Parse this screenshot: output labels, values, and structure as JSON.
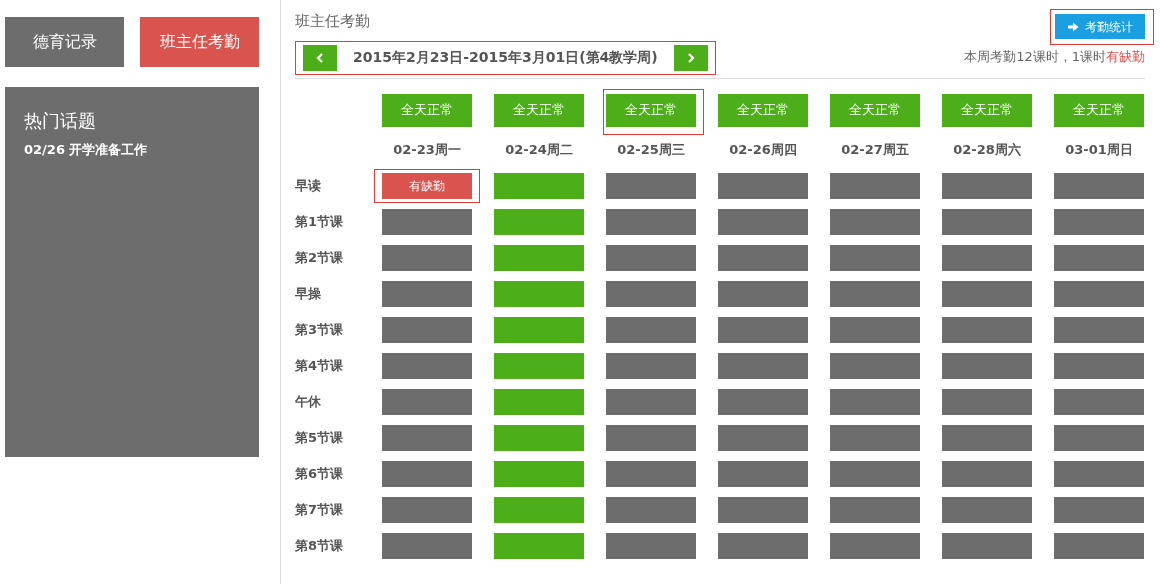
{
  "sidebar": {
    "buttons": [
      {
        "label": "德育记录",
        "selected": false
      },
      {
        "label": "班主任考勤",
        "selected": true
      }
    ],
    "hot_topics": {
      "title": "热门话题",
      "items": [
        "02/26 开学准备工作"
      ]
    }
  },
  "main": {
    "title": "班主任考勤",
    "stats_button": {
      "label": "考勤统计",
      "highlighted": true
    },
    "week_nav": {
      "range": "2015年2月23日-2015年3月01日(第4教学周)",
      "highlighted": true
    },
    "summary": {
      "text": "本周考勤12课时，1课时",
      "alert": "有缺勤"
    },
    "days": [
      {
        "status": "全天正常",
        "date": "02-23周一",
        "highlighted": false
      },
      {
        "status": "全天正常",
        "date": "02-24周二",
        "highlighted": false
      },
      {
        "status": "全天正常",
        "date": "02-25周三",
        "highlighted": true
      },
      {
        "status": "全天正常",
        "date": "02-26周四",
        "highlighted": false
      },
      {
        "status": "全天正常",
        "date": "02-27周五",
        "highlighted": false
      },
      {
        "status": "全天正常",
        "date": "02-28周六",
        "highlighted": false
      },
      {
        "status": "全天正常",
        "date": "03-01周日",
        "highlighted": false
      }
    ],
    "rows": [
      {
        "label": "早读",
        "cells": [
          {
            "kind": "absent",
            "text": "有缺勤",
            "highlighted": true
          },
          {
            "kind": "normal"
          },
          {
            "kind": "empty"
          },
          {
            "kind": "empty"
          },
          {
            "kind": "empty"
          },
          {
            "kind": "empty"
          },
          {
            "kind": "empty"
          }
        ]
      },
      {
        "label": "第1节课",
        "cells": [
          {
            "kind": "empty"
          },
          {
            "kind": "normal"
          },
          {
            "kind": "empty"
          },
          {
            "kind": "empty"
          },
          {
            "kind": "empty"
          },
          {
            "kind": "empty"
          },
          {
            "kind": "empty"
          }
        ]
      },
      {
        "label": "第2节课",
        "cells": [
          {
            "kind": "empty"
          },
          {
            "kind": "normal"
          },
          {
            "kind": "empty"
          },
          {
            "kind": "empty"
          },
          {
            "kind": "empty"
          },
          {
            "kind": "empty"
          },
          {
            "kind": "empty"
          }
        ]
      },
      {
        "label": "早操",
        "cells": [
          {
            "kind": "empty"
          },
          {
            "kind": "normal"
          },
          {
            "kind": "empty"
          },
          {
            "kind": "empty"
          },
          {
            "kind": "empty"
          },
          {
            "kind": "empty"
          },
          {
            "kind": "empty"
          }
        ]
      },
      {
        "label": "第3节课",
        "cells": [
          {
            "kind": "empty"
          },
          {
            "kind": "normal"
          },
          {
            "kind": "empty"
          },
          {
            "kind": "empty"
          },
          {
            "kind": "empty"
          },
          {
            "kind": "empty"
          },
          {
            "kind": "empty"
          }
        ]
      },
      {
        "label": "第4节课",
        "cells": [
          {
            "kind": "empty"
          },
          {
            "kind": "normal"
          },
          {
            "kind": "empty"
          },
          {
            "kind": "empty"
          },
          {
            "kind": "empty"
          },
          {
            "kind": "empty"
          },
          {
            "kind": "empty"
          }
        ]
      },
      {
        "label": "午休",
        "cells": [
          {
            "kind": "empty"
          },
          {
            "kind": "normal"
          },
          {
            "kind": "empty"
          },
          {
            "kind": "empty"
          },
          {
            "kind": "empty"
          },
          {
            "kind": "empty"
          },
          {
            "kind": "empty"
          }
        ]
      },
      {
        "label": "第5节课",
        "cells": [
          {
            "kind": "empty"
          },
          {
            "kind": "normal"
          },
          {
            "kind": "empty"
          },
          {
            "kind": "empty"
          },
          {
            "kind": "empty"
          },
          {
            "kind": "empty"
          },
          {
            "kind": "empty"
          }
        ]
      },
      {
        "label": "第6节课",
        "cells": [
          {
            "kind": "empty"
          },
          {
            "kind": "normal"
          },
          {
            "kind": "empty"
          },
          {
            "kind": "empty"
          },
          {
            "kind": "empty"
          },
          {
            "kind": "empty"
          },
          {
            "kind": "empty"
          }
        ]
      },
      {
        "label": "第7节课",
        "cells": [
          {
            "kind": "empty"
          },
          {
            "kind": "normal"
          },
          {
            "kind": "empty"
          },
          {
            "kind": "empty"
          },
          {
            "kind": "empty"
          },
          {
            "kind": "empty"
          },
          {
            "kind": "empty"
          }
        ]
      },
      {
        "label": "第8节课",
        "cells": [
          {
            "kind": "empty"
          },
          {
            "kind": "normal"
          },
          {
            "kind": "empty"
          },
          {
            "kind": "empty"
          },
          {
            "kind": "empty"
          },
          {
            "kind": "empty"
          },
          {
            "kind": "empty"
          }
        ]
      }
    ]
  }
}
